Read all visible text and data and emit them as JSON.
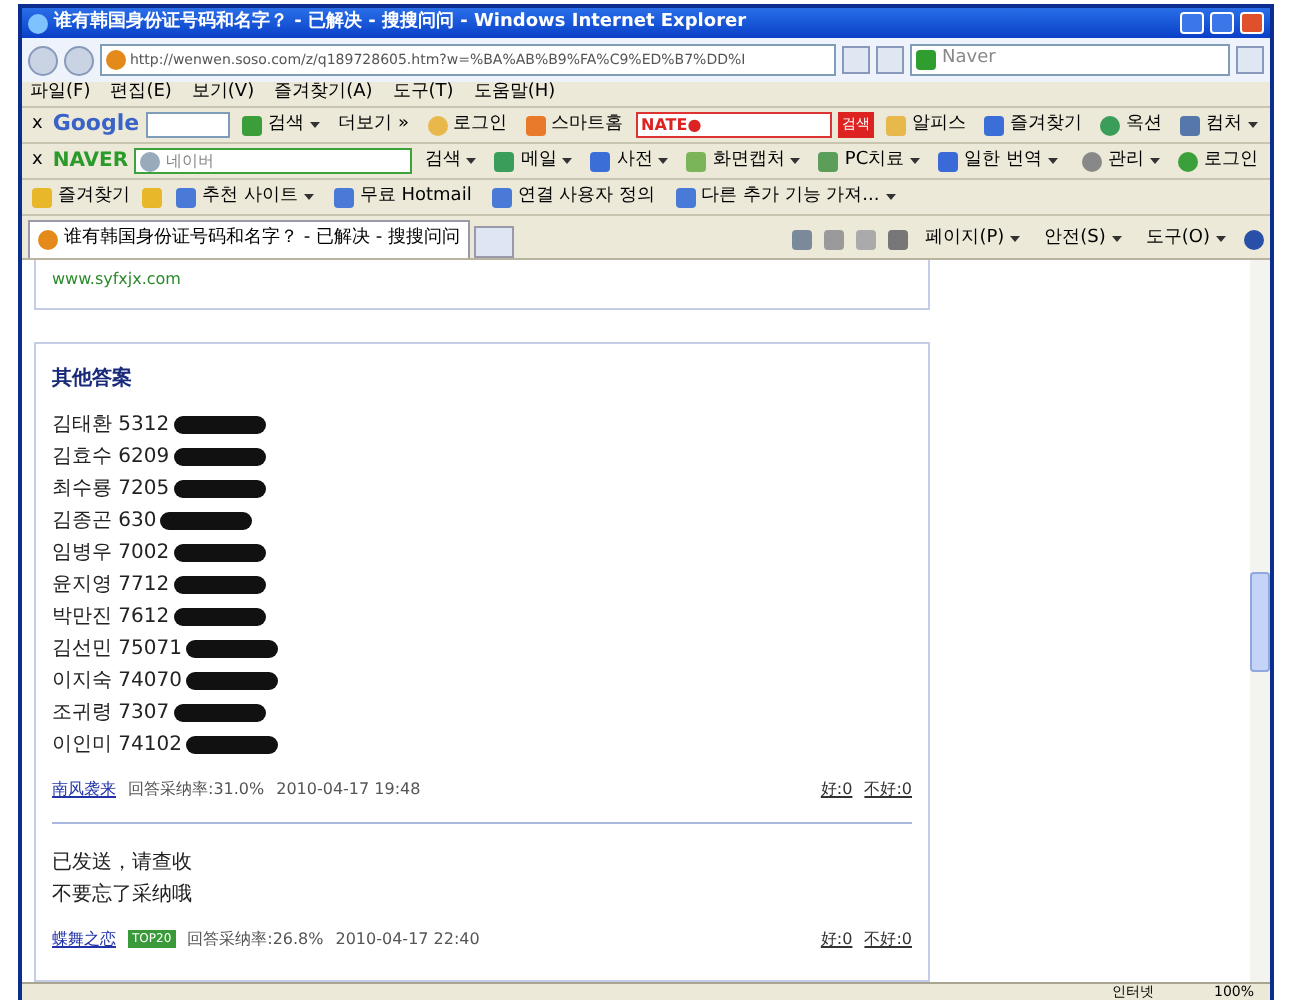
{
  "window": {
    "title": "谁有韩国身份证号码和名字？ - 已解决 - 搜搜问问 - Windows Internet Explorer"
  },
  "address": {
    "url": "http://wenwen.soso.com/z/q189728605.htm?w=%BA%AB%B9%FA%C9%ED%B7%DD%I",
    "search": "Naver"
  },
  "menu": [
    "파일(F)",
    "편집(E)",
    "보기(V)",
    "즐겨찾기(A)",
    "도구(T)",
    "도움말(H)"
  ],
  "google_toolbar": {
    "close": "x",
    "logo": "Google",
    "items": [
      {
        "label": "검색",
        "has_menu": true
      },
      {
        "label": "더보기 »",
        "has_menu": false
      },
      {
        "label": "로그인",
        "has_menu": false
      },
      {
        "label": "스마트홈",
        "has_menu": false
      }
    ],
    "nate": "NATE●",
    "nate_button": "검색",
    "right_items": [
      {
        "label": "알피스",
        "has_menu": false
      },
      {
        "label": "즐겨찾기",
        "has_menu": false
      },
      {
        "label": "옥션",
        "has_menu": false
      },
      {
        "label": "컴처",
        "has_menu": true
      }
    ]
  },
  "naver_toolbar": {
    "close": "x",
    "logo": "NAVER",
    "placeholder": "네이버",
    "items": [
      {
        "label": "검색",
        "has_menu": true
      },
      {
        "label": "메일",
        "has_menu": true
      },
      {
        "label": "사전",
        "has_menu": true
      },
      {
        "label": "화면캡처",
        "has_menu": true
      },
      {
        "label": "PC치료",
        "has_menu": true
      },
      {
        "label": "일한 번역",
        "has_menu": true
      }
    ],
    "right_items": [
      {
        "label": "관리",
        "has_menu": true
      },
      {
        "label": "로그인",
        "has_menu": false
      }
    ]
  },
  "favorites": {
    "label": "즐겨찾기",
    "items": [
      {
        "label": "추천 사이트",
        "has_menu": true
      },
      {
        "label": "무료 Hotmail",
        "has_menu": false
      },
      {
        "label": "연결 사용자 정의",
        "has_menu": false
      },
      {
        "label": "다른 추가 기능 가져...",
        "has_menu": true
      }
    ]
  },
  "tabs": [
    {
      "title": "谁有韩国身份证号码和名字？ - 已解决 - 搜搜问问",
      "selected": true
    }
  ],
  "command_bar": [
    "페이지(P)",
    "안전(S)",
    "도구(O)"
  ],
  "content": {
    "top_link": "www.syfxjx.com",
    "section_title": "其他答案",
    "answers": [
      {
        "lines": [
          "김태환 5312",
          "김효수 6209",
          "최수룡 7205",
          "김종곤 630",
          "임병우 7002",
          "윤지영 7712",
          "박만진 7612",
          "김선민 75071",
          "이지숙 74070",
          "조귀령 7307",
          "이인미 74102"
        ],
        "redacted": true,
        "user": "南风袭来",
        "rate": "回答采纳率:31.0%",
        "time": "2010-04-17 19:48",
        "good": "好:0",
        "bad": "不好:0"
      },
      {
        "lines": [
          "已发送，请查收",
          "不要忘了采纳哦"
        ],
        "redacted": false,
        "user": "蝶舞之恋",
        "badge": "TOP20",
        "rate": "回答采纳率:26.8%",
        "time": "2010-04-17 22:40",
        "good": "好:0",
        "bad": "不好:0"
      }
    ]
  },
  "status_bar": {
    "zone": "인터넷",
    "zoom": "100%"
  }
}
